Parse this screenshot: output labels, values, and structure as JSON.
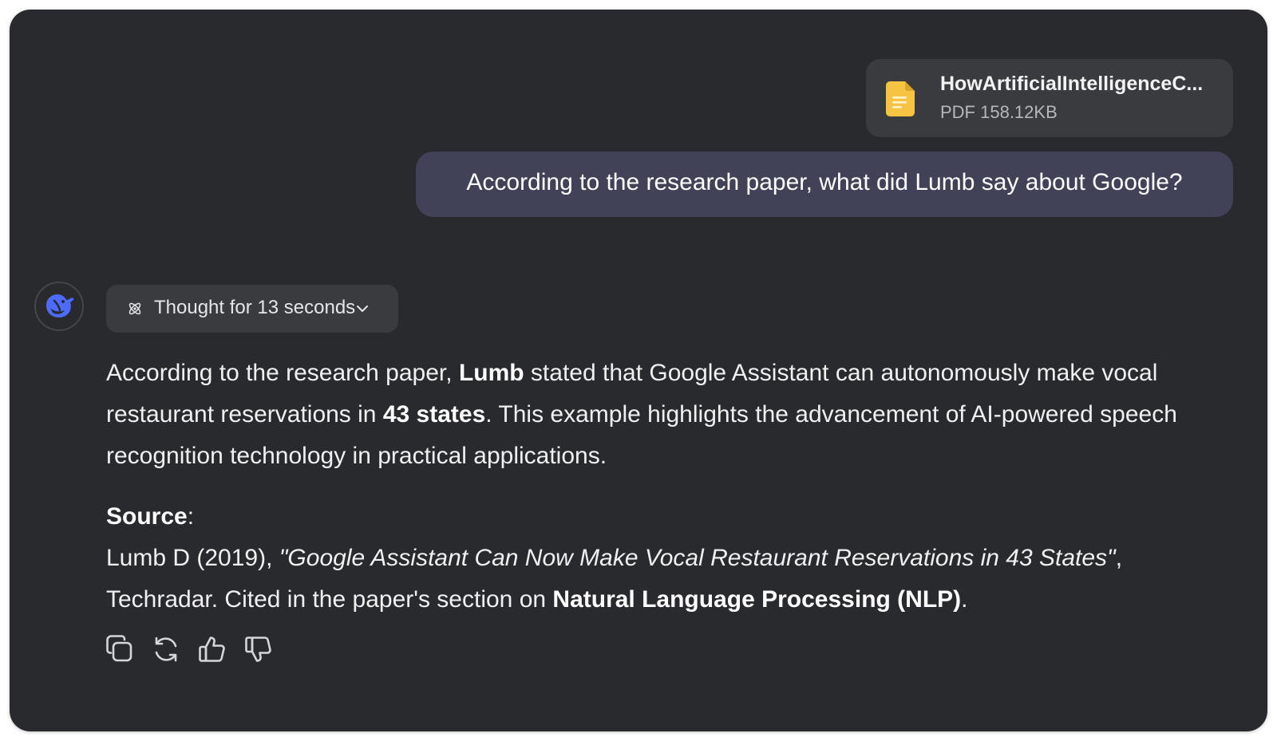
{
  "attachment": {
    "file_name": "HowArtificialIntelligenceC...",
    "file_meta": "PDF 158.12KB",
    "icon": "document-icon",
    "icon_color": "#f6c343"
  },
  "user_message": {
    "text": "According to the research paper, what did Lumb say about Google?"
  },
  "assistant": {
    "avatar_icon": "whale-logo-icon",
    "avatar_color": "#4d6bfe",
    "thought_chip": {
      "label": "Thought for 13 seconds",
      "icon": "atom-icon",
      "chevron": "chevron-down-icon"
    },
    "answer": {
      "p1_a": "According to the research paper, ",
      "p1_b": "Lumb",
      "p1_c": " stated that Google Assistant can autonomously make vocal restaurant reservations in ",
      "p1_d": "43 states",
      "p1_e": ". This example highlights the advancement of AI-powered speech recognition technology in practical applications.",
      "source_label": "Source",
      "source_colon": ":",
      "src_a": "Lumb D (2019), ",
      "src_b": "\"Google Assistant Can Now Make Vocal Restaurant Reservations in 43 States\"",
      "src_c": ", Techradar. Cited in the paper's section on ",
      "src_d": "Natural Language Processing (NLP)",
      "src_e": "."
    },
    "actions": [
      {
        "name": "copy-icon"
      },
      {
        "name": "regenerate-icon"
      },
      {
        "name": "thumbs-up-icon"
      },
      {
        "name": "thumbs-down-icon"
      }
    ]
  }
}
